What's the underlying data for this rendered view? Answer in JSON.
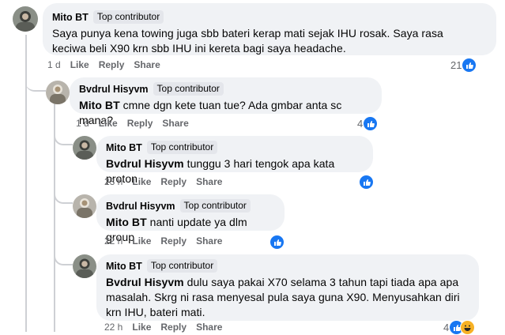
{
  "comments": [
    {
      "name": "Mito BT",
      "badge": "Top contributor",
      "text_lines": [
        "Saya punya kena towing juga sbb bateri kerap mati sejak IHU rosak. Saya rasa",
        "keciwa beli X90 krn sbb IHU ini kereta bagi saya headache."
      ],
      "time": "1 d",
      "like": "Like",
      "reply": "Reply",
      "share": "Share",
      "reactions": "21"
    },
    {
      "name": "Bvdrul Hisyvm",
      "badge": "Top contributor",
      "mention": "Mito BT",
      "text": " cmne dgn kete tuan tue? Ada gmbar anta sc mana?",
      "time": "1 d",
      "like": "Like",
      "reply": "Reply",
      "share": "Share",
      "reactions": "4"
    },
    {
      "name": "Mito BT",
      "badge": "Top contributor",
      "mention": "Bvdrul Hisyvm",
      "text": " tunggu 3 hari tengok apa kata proton",
      "time": "23 h",
      "like": "Like",
      "reply": "Reply",
      "share": "Share"
    },
    {
      "name": "Bvdrul Hisyvm",
      "badge": "Top contributor",
      "mention": "Mito BT",
      "text": " nanti update ya dlm group",
      "time": "22 h",
      "like": "Like",
      "reply": "Reply",
      "share": "Share"
    },
    {
      "name": "Mito BT",
      "badge": "Top contributor",
      "mention": "Bvdrul Hisyvm",
      "text_first": " dulu saya pakai X70 selama 3 tahun tapi tiada apa apa",
      "text_lines": [
        "masalah. Skrg ni rasa menyesal pula saya guna X90. Menyusahkan diri",
        "krn IHU, bateri mati."
      ],
      "time": "22 h",
      "like": "Like",
      "reply": "Reply",
      "share": "Share",
      "reactions": "4"
    }
  ],
  "colors": {
    "accent": "#1877f2",
    "bubble": "#f0f2f5",
    "muted": "#65676b"
  }
}
